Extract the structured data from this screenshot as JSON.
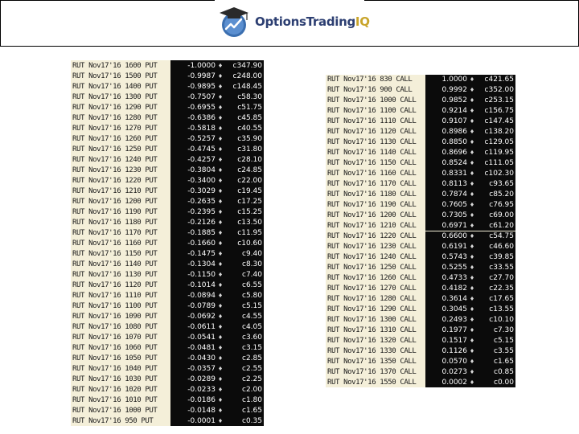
{
  "header": {
    "logo_text": "OptionsTrading",
    "logo_suffix": "IQ",
    "colors": {
      "banner_border": "#000000",
      "logo_blue": "#2d3f72",
      "logo_gold": "#c9a52c",
      "table_bg": "#f4efd9",
      "value_bg": "#0b0b0b"
    }
  },
  "puts": {
    "rows": [
      {
        "sym": "RUT Nov17'16 1600 PUT",
        "delta": "-1.0000",
        "price": "c347.90"
      },
      {
        "sym": "RUT Nov17'16 1500 PUT",
        "delta": "-0.9987",
        "price": "c248.00"
      },
      {
        "sym": "RUT Nov17'16 1400 PUT",
        "delta": "-0.9895",
        "price": "c148.45"
      },
      {
        "sym": "RUT Nov17'16 1300 PUT",
        "delta": "-0.7507",
        "price": "c58.30"
      },
      {
        "sym": "RUT Nov17'16 1290 PUT",
        "delta": "-0.6955",
        "price": "c51.75"
      },
      {
        "sym": "RUT Nov17'16 1280 PUT",
        "delta": "-0.6386",
        "price": "c45.85"
      },
      {
        "sym": "RUT Nov17'16 1270 PUT",
        "delta": "-0.5818",
        "price": "c40.55"
      },
      {
        "sym": "RUT Nov17'16 1260 PUT",
        "delta": "-0.5257",
        "price": "c35.90"
      },
      {
        "sym": "RUT Nov17'16 1250 PUT",
        "delta": "-0.4745",
        "price": "c31.80"
      },
      {
        "sym": "RUT Nov17'16 1240 PUT",
        "delta": "-0.4257",
        "price": "c28.10"
      },
      {
        "sym": "RUT Nov17'16 1230 PUT",
        "delta": "-0.3804",
        "price": "c24.85"
      },
      {
        "sym": "RUT Nov17'16 1220 PUT",
        "delta": "-0.3400",
        "price": "c22.00"
      },
      {
        "sym": "RUT Nov17'16 1210 PUT",
        "delta": "-0.3029",
        "price": "c19.45"
      },
      {
        "sym": "RUT Nov17'16 1200 PUT",
        "delta": "-0.2635",
        "price": "c17.25"
      },
      {
        "sym": "RUT Nov17'16 1190 PUT",
        "delta": "-0.2395",
        "price": "c15.25"
      },
      {
        "sym": "RUT Nov17'16 1180 PUT",
        "delta": "-0.2126",
        "price": "c13.50"
      },
      {
        "sym": "RUT Nov17'16 1170 PUT",
        "delta": "-0.1885",
        "price": "c11.95"
      },
      {
        "sym": "RUT Nov17'16 1160 PUT",
        "delta": "-0.1660",
        "price": "c10.60"
      },
      {
        "sym": "RUT Nov17'16 1150 PUT",
        "delta": "-0.1475",
        "price": "c9.40"
      },
      {
        "sym": "RUT Nov17'16 1140 PUT",
        "delta": "-0.1304",
        "price": "c8.30"
      },
      {
        "sym": "RUT Nov17'16 1130 PUT",
        "delta": "-0.1150",
        "price": "c7.40"
      },
      {
        "sym": "RUT Nov17'16 1120 PUT",
        "delta": "-0.1014",
        "price": "c6.55"
      },
      {
        "sym": "RUT Nov17'16 1110 PUT",
        "delta": "-0.0894",
        "price": "c5.80"
      },
      {
        "sym": "RUT Nov17'16 1100 PUT",
        "delta": "-0.0789",
        "price": "c5.15"
      },
      {
        "sym": "RUT Nov17'16 1090 PUT",
        "delta": "-0.0692",
        "price": "c4.55"
      },
      {
        "sym": "RUT Nov17'16 1080 PUT",
        "delta": "-0.0611",
        "price": "c4.05"
      },
      {
        "sym": "RUT Nov17'16 1070 PUT",
        "delta": "-0.0541",
        "price": "c3.60"
      },
      {
        "sym": "RUT Nov17'16 1060 PUT",
        "delta": "-0.0481",
        "price": "c3.15"
      },
      {
        "sym": "RUT Nov17'16 1050 PUT",
        "delta": "-0.0430",
        "price": "c2.85"
      },
      {
        "sym": "RUT Nov17'16 1040 PUT",
        "delta": "-0.0357",
        "price": "c2.55"
      },
      {
        "sym": "RUT Nov17'16 1030 PUT",
        "delta": "-0.0289",
        "price": "c2.25"
      },
      {
        "sym": "RUT Nov17'16 1020 PUT",
        "delta": "-0.0233",
        "price": "c2.00"
      },
      {
        "sym": "RUT Nov17'16 1010 PUT",
        "delta": "-0.0186",
        "price": "c1.80"
      },
      {
        "sym": "RUT Nov17'16 1000 PUT",
        "delta": "-0.0148",
        "price": "c1.65"
      },
      {
        "sym": "RUT Nov17'16 950 PUT",
        "delta": "-0.0001",
        "price": "c0.35"
      }
    ]
  },
  "calls": {
    "rows": [
      {
        "sym": "RUT Nov17'16 830 CALL",
        "delta": "1.0000",
        "price": "c421.65"
      },
      {
        "sym": "RUT Nov17'16 900 CALL",
        "delta": "0.9992",
        "price": "c352.00"
      },
      {
        "sym": "RUT Nov17'16 1000 CALL",
        "delta": "0.9852",
        "price": "c253.15"
      },
      {
        "sym": "RUT Nov17'16 1100 CALL",
        "delta": "0.9214",
        "price": "c156.75"
      },
      {
        "sym": "RUT Nov17'16 1110 CALL",
        "delta": "0.9107",
        "price": "c147.45"
      },
      {
        "sym": "RUT Nov17'16 1120 CALL",
        "delta": "0.8986",
        "price": "c138.20"
      },
      {
        "sym": "RUT Nov17'16 1130 CALL",
        "delta": "0.8850",
        "price": "c129.05"
      },
      {
        "sym": "RUT Nov17'16 1140 CALL",
        "delta": "0.8696",
        "price": "c119.95"
      },
      {
        "sym": "RUT Nov17'16 1150 CALL",
        "delta": "0.8524",
        "price": "c111.05"
      },
      {
        "sym": "RUT Nov17'16 1160 CALL",
        "delta": "0.8331",
        "price": "c102.30"
      },
      {
        "sym": "RUT Nov17'16 1170 CALL",
        "delta": "0.8113",
        "price": "c93.65"
      },
      {
        "sym": "RUT Nov17'16 1180 CALL",
        "delta": "0.7874",
        "price": "c85.20"
      },
      {
        "sym": "RUT Nov17'16 1190 CALL",
        "delta": "0.7605",
        "price": "c76.95"
      },
      {
        "sym": "RUT Nov17'16 1200 CALL",
        "delta": "0.7305",
        "price": "c69.00"
      },
      {
        "sym": "RUT Nov17'16 1210 CALL",
        "delta": "0.6971",
        "price": "c61.20"
      },
      {
        "sym": "RUT Nov17'16 1220 CALL",
        "delta": "0.6600",
        "price": "c54.75"
      },
      {
        "sym": "RUT Nov17'16 1230 CALL",
        "delta": "0.6191",
        "price": "c46.60"
      },
      {
        "sym": "RUT Nov17'16 1240 CALL",
        "delta": "0.5743",
        "price": "c39.85"
      },
      {
        "sym": "RUT Nov17'16 1250 CALL",
        "delta": "0.5255",
        "price": "c33.55"
      },
      {
        "sym": "RUT Nov17'16 1260 CALL",
        "delta": "0.4733",
        "price": "c27.70"
      },
      {
        "sym": "RUT Nov17'16 1270 CALL",
        "delta": "0.4182",
        "price": "c22.35"
      },
      {
        "sym": "RUT Nov17'16 1280 CALL",
        "delta": "0.3614",
        "price": "c17.65"
      },
      {
        "sym": "RUT Nov17'16 1290 CALL",
        "delta": "0.3045",
        "price": "c13.55"
      },
      {
        "sym": "RUT Nov17'16 1300 CALL",
        "delta": "0.2493",
        "price": "c10.10"
      },
      {
        "sym": "RUT Nov17'16 1310 CALL",
        "delta": "0.1977",
        "price": "c7.30"
      },
      {
        "sym": "RUT Nov17'16 1320 CALL",
        "delta": "0.1517",
        "price": "c5.15"
      },
      {
        "sym": "RUT Nov17'16 1330 CALL",
        "delta": "0.1126",
        "price": "c3.55"
      },
      {
        "sym": "RUT Nov17'16 1350 CALL",
        "delta": "0.0570",
        "price": "c1.65"
      },
      {
        "sym": "RUT Nov17'16 1370 CALL",
        "delta": "0.0273",
        "price": "c0.85"
      },
      {
        "sym": "RUT Nov17'16 1550 CALL",
        "delta": "0.0002",
        "price": "c0.00"
      }
    ]
  }
}
